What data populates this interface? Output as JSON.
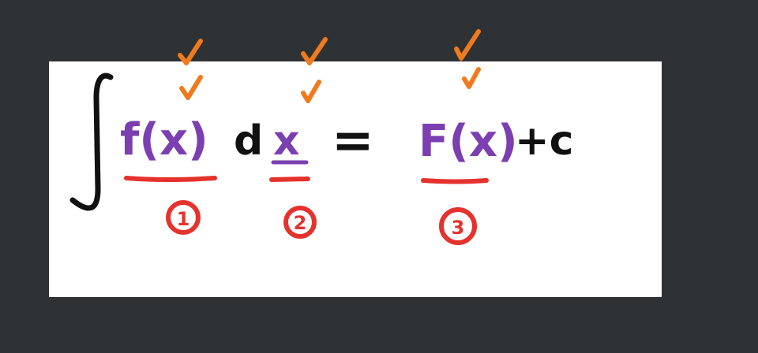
{
  "equation": {
    "integrand": "f(x)",
    "differential_d": "d",
    "variable": "x",
    "equals": "=",
    "antiderivative": "F(x)",
    "constant": "+c"
  },
  "markers": [
    {
      "label": "1"
    },
    {
      "label": "2"
    },
    {
      "label": "3"
    }
  ],
  "colors": {
    "background": "#2f3234",
    "board": "#ffffff",
    "ink": "#111111",
    "purple": "#7b3fb1",
    "red": "#e5322d",
    "orange": "#f07a1e"
  }
}
